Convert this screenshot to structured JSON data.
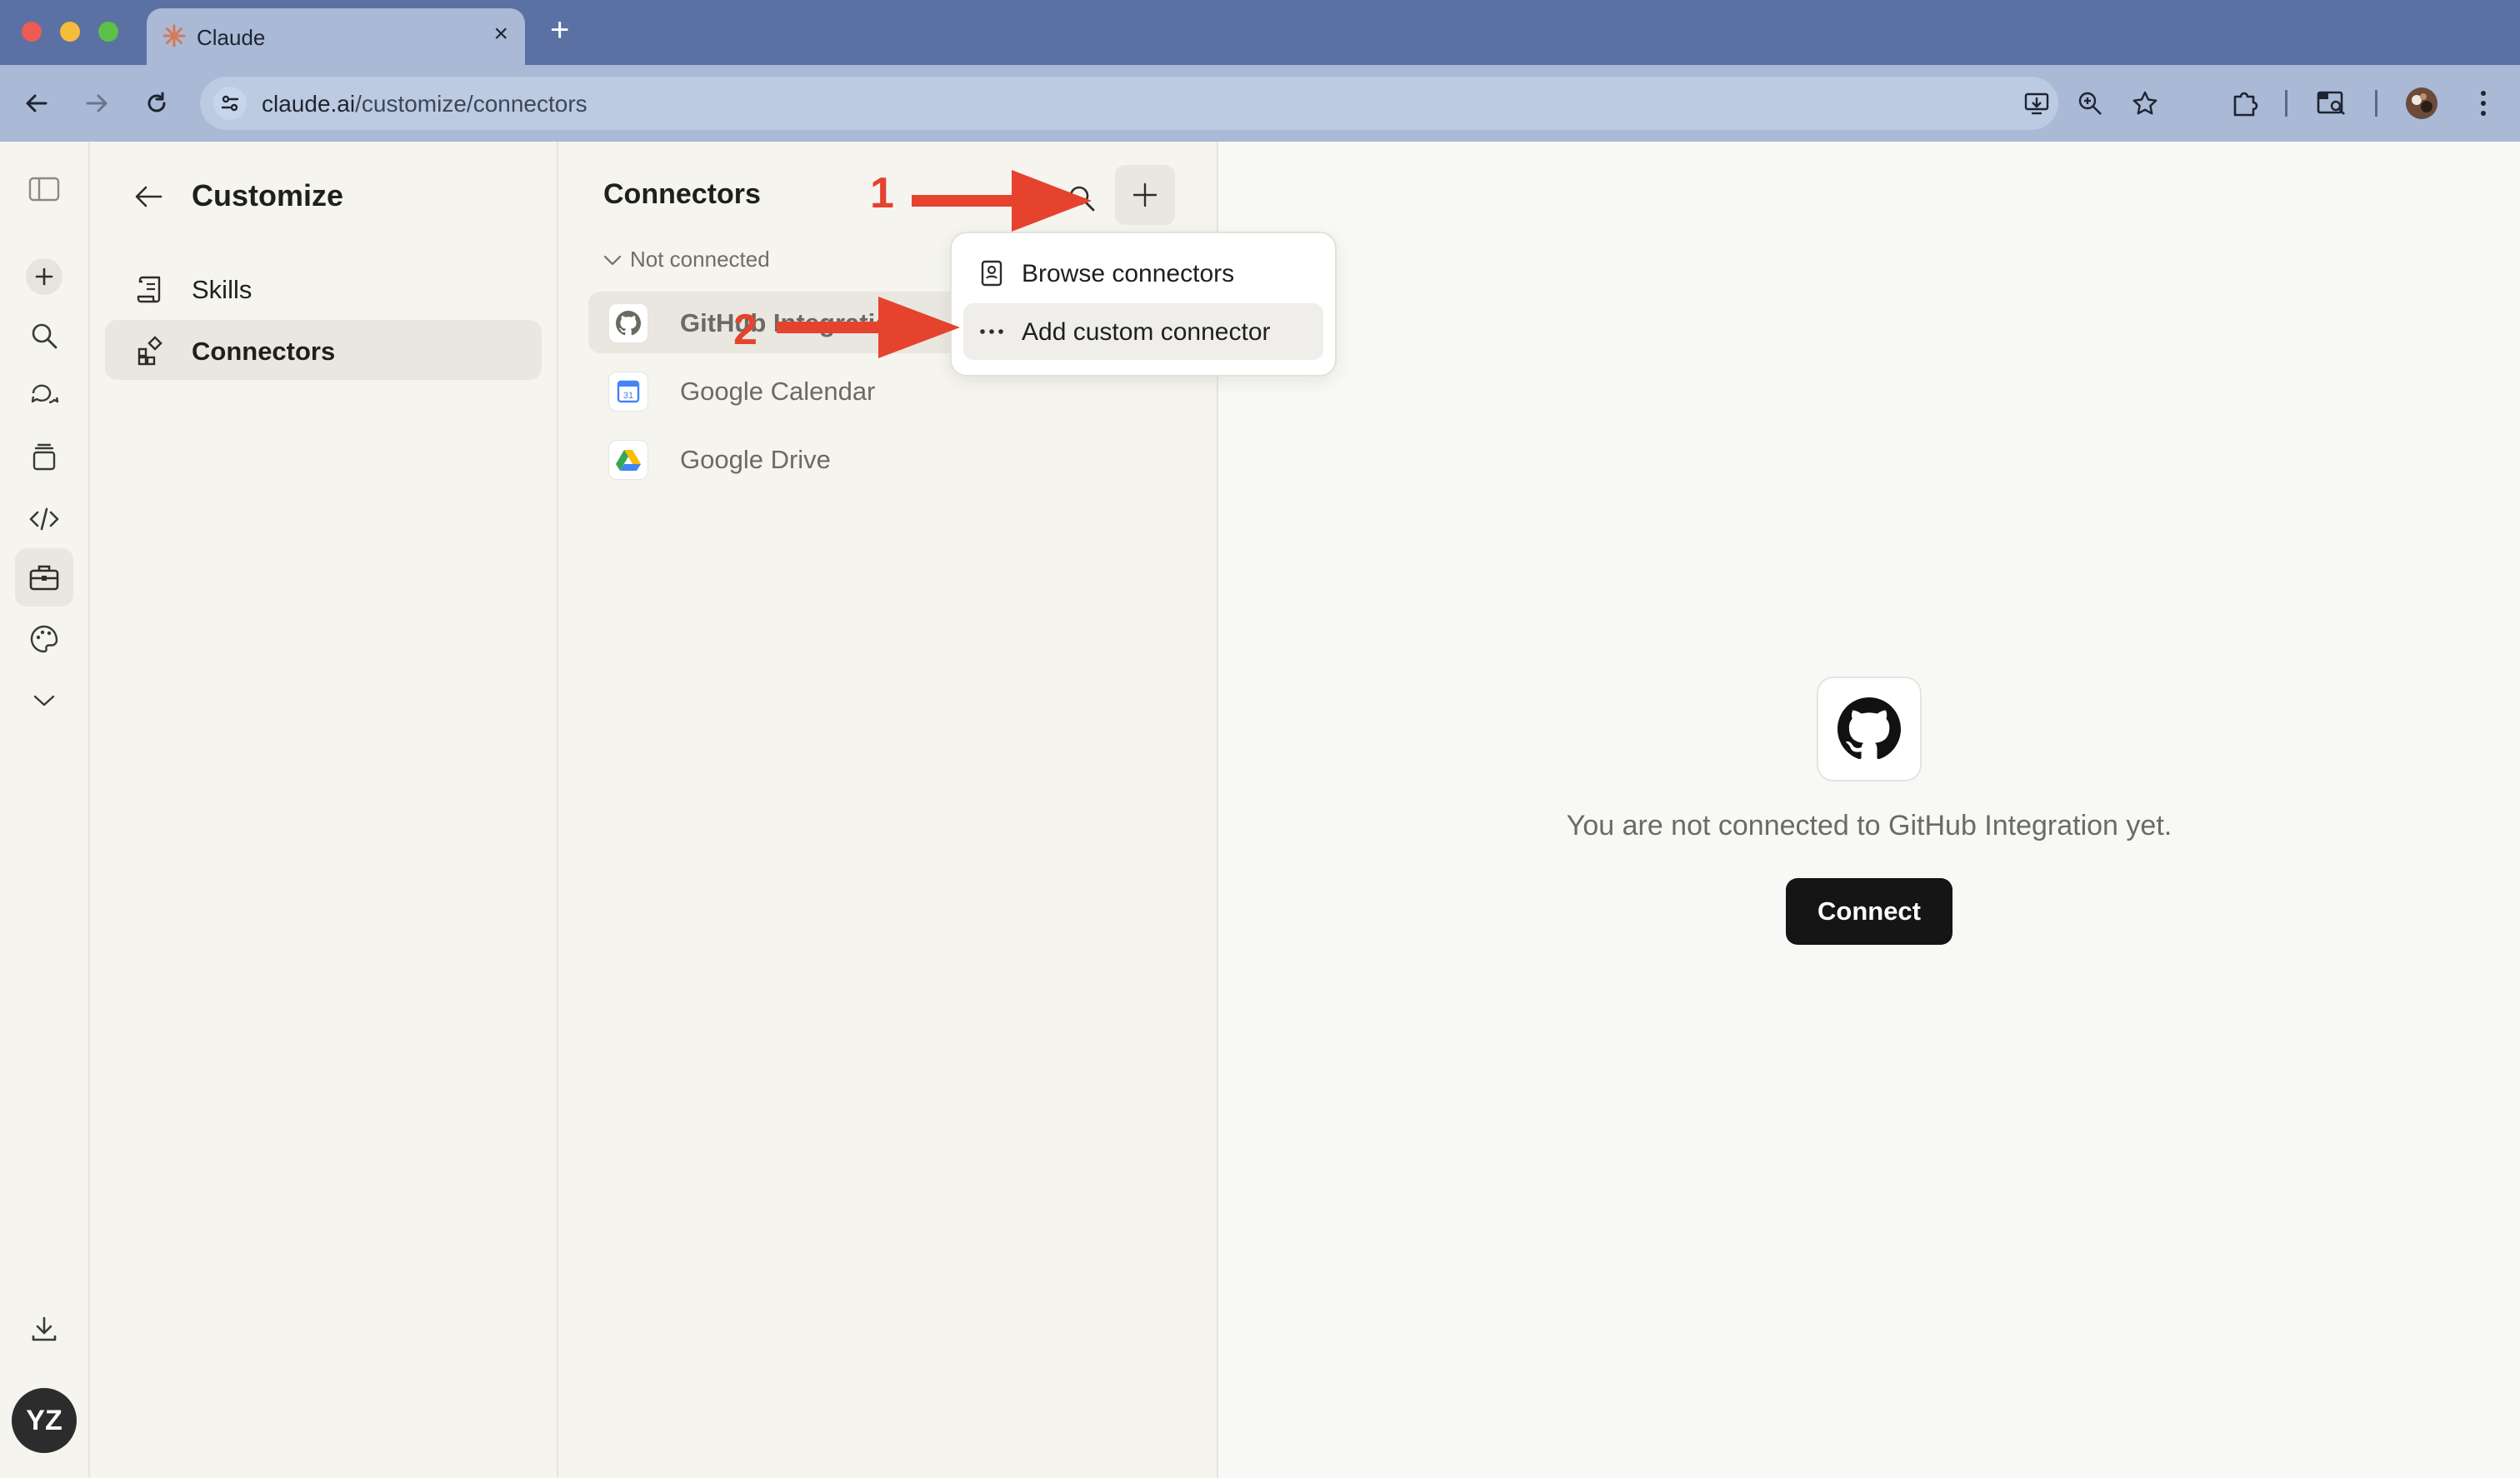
{
  "browser": {
    "tab_title": "Claude",
    "new_tab": "+",
    "tab_close": "×",
    "url_host": "claude.ai",
    "url_path": "/customize/connectors"
  },
  "rail": {
    "avatar_initials": "YZ"
  },
  "customize": {
    "title": "Customize",
    "nav": [
      {
        "label": "Skills"
      },
      {
        "label": "Connectors"
      }
    ]
  },
  "connectors": {
    "title": "Connectors",
    "group_label": "Not connected",
    "items": [
      {
        "label": "GitHub Integration"
      },
      {
        "label": "Google Calendar"
      },
      {
        "label": "Google Drive"
      }
    ]
  },
  "menu": {
    "items": [
      {
        "label": "Browse connectors",
        "icon": "book-icon"
      },
      {
        "label": "Add custom connector",
        "icon": "more-horizontal-icon"
      }
    ]
  },
  "detail": {
    "message": "You are not connected to GitHub Integration yet.",
    "connect_label": "Connect"
  },
  "annotations": {
    "step1": "1",
    "step2": "2",
    "color": "#e5432d"
  }
}
